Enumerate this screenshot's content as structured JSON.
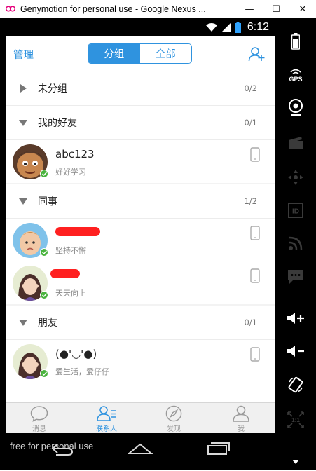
{
  "window": {
    "title": "Genymotion for personal use - Google Nexus ...",
    "minimize_glyph": "—",
    "maximize_glyph": "☐",
    "close_glyph": "✕"
  },
  "statusbar": {
    "time": "6:12"
  },
  "appbar": {
    "manage_label": "管理",
    "tabs": [
      {
        "label": "分组",
        "active": true
      },
      {
        "label": "全部",
        "active": false
      }
    ]
  },
  "groups": [
    {
      "name": "未分组",
      "count": "0/2",
      "expanded": false,
      "contacts": []
    },
    {
      "name": "我的好友",
      "count": "0/1",
      "expanded": true,
      "contacts": [
        {
          "name": "abc123",
          "signature": "好好学习",
          "avatar": "cartoon-boy"
        }
      ]
    },
    {
      "name": "同事",
      "count": "1/2",
      "expanded": true,
      "contacts": [
        {
          "name": "",
          "signature": "坚持不懈",
          "avatar": "child-photo",
          "redacted": true
        },
        {
          "name": "",
          "signature": "天天向上",
          "avatar": "girl-photo",
          "redacted": true
        }
      ]
    },
    {
      "name": "朋友",
      "count": "0/1",
      "expanded": true,
      "contacts": [
        {
          "name": "(●'◡'●)",
          "signature": "爱生活，爱仔仔",
          "avatar": "girl-photo"
        }
      ]
    }
  ],
  "tabbar": [
    {
      "label": "消息",
      "icon": "chat-bubble-icon",
      "active": false
    },
    {
      "label": "联系人",
      "icon": "contacts-icon",
      "active": true
    },
    {
      "label": "发现",
      "icon": "compass-icon",
      "active": false
    },
    {
      "label": "我",
      "icon": "person-icon",
      "active": false
    }
  ],
  "watermark": "free for personal use",
  "sidebar": [
    "battery-icon",
    "gps-icon",
    "camera-icon",
    "clapper-icon",
    "dpad-icon",
    "id-icon",
    "rss-icon",
    "sms-icon",
    "volume-up-icon",
    "volume-down-icon",
    "rotate-icon",
    "scale-icon"
  ],
  "sidebar_labels": {
    "gps": "GPS",
    "id": "ID",
    "scale": "1:1"
  },
  "colors": {
    "accent": "#2f93df",
    "online": "#49b33d",
    "redact": "#ff2020"
  }
}
